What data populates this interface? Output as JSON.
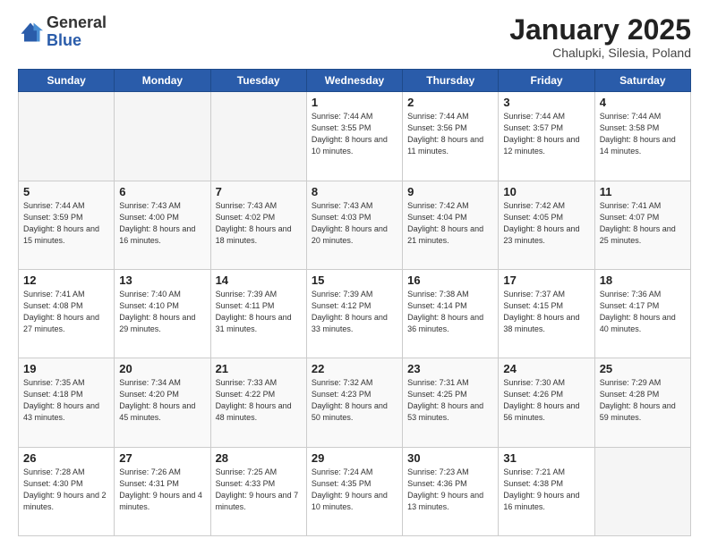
{
  "logo": {
    "general": "General",
    "blue": "Blue"
  },
  "header": {
    "month": "January 2025",
    "location": "Chalupki, Silesia, Poland"
  },
  "days_of_week": [
    "Sunday",
    "Monday",
    "Tuesday",
    "Wednesday",
    "Thursday",
    "Friday",
    "Saturday"
  ],
  "weeks": [
    [
      {
        "day": "",
        "empty": true
      },
      {
        "day": "",
        "empty": true
      },
      {
        "day": "",
        "empty": true
      },
      {
        "day": "1",
        "sunrise": "7:44 AM",
        "sunset": "3:55 PM",
        "daylight": "8 hours and 10 minutes."
      },
      {
        "day": "2",
        "sunrise": "7:44 AM",
        "sunset": "3:56 PM",
        "daylight": "8 hours and 11 minutes."
      },
      {
        "day": "3",
        "sunrise": "7:44 AM",
        "sunset": "3:57 PM",
        "daylight": "8 hours and 12 minutes."
      },
      {
        "day": "4",
        "sunrise": "7:44 AM",
        "sunset": "3:58 PM",
        "daylight": "8 hours and 14 minutes."
      }
    ],
    [
      {
        "day": "5",
        "sunrise": "7:44 AM",
        "sunset": "3:59 PM",
        "daylight": "8 hours and 15 minutes."
      },
      {
        "day": "6",
        "sunrise": "7:43 AM",
        "sunset": "4:00 PM",
        "daylight": "8 hours and 16 minutes."
      },
      {
        "day": "7",
        "sunrise": "7:43 AM",
        "sunset": "4:02 PM",
        "daylight": "8 hours and 18 minutes."
      },
      {
        "day": "8",
        "sunrise": "7:43 AM",
        "sunset": "4:03 PM",
        "daylight": "8 hours and 20 minutes."
      },
      {
        "day": "9",
        "sunrise": "7:42 AM",
        "sunset": "4:04 PM",
        "daylight": "8 hours and 21 minutes."
      },
      {
        "day": "10",
        "sunrise": "7:42 AM",
        "sunset": "4:05 PM",
        "daylight": "8 hours and 23 minutes."
      },
      {
        "day": "11",
        "sunrise": "7:41 AM",
        "sunset": "4:07 PM",
        "daylight": "8 hours and 25 minutes."
      }
    ],
    [
      {
        "day": "12",
        "sunrise": "7:41 AM",
        "sunset": "4:08 PM",
        "daylight": "8 hours and 27 minutes."
      },
      {
        "day": "13",
        "sunrise": "7:40 AM",
        "sunset": "4:10 PM",
        "daylight": "8 hours and 29 minutes."
      },
      {
        "day": "14",
        "sunrise": "7:39 AM",
        "sunset": "4:11 PM",
        "daylight": "8 hours and 31 minutes."
      },
      {
        "day": "15",
        "sunrise": "7:39 AM",
        "sunset": "4:12 PM",
        "daylight": "8 hours and 33 minutes."
      },
      {
        "day": "16",
        "sunrise": "7:38 AM",
        "sunset": "4:14 PM",
        "daylight": "8 hours and 36 minutes."
      },
      {
        "day": "17",
        "sunrise": "7:37 AM",
        "sunset": "4:15 PM",
        "daylight": "8 hours and 38 minutes."
      },
      {
        "day": "18",
        "sunrise": "7:36 AM",
        "sunset": "4:17 PM",
        "daylight": "8 hours and 40 minutes."
      }
    ],
    [
      {
        "day": "19",
        "sunrise": "7:35 AM",
        "sunset": "4:18 PM",
        "daylight": "8 hours and 43 minutes."
      },
      {
        "day": "20",
        "sunrise": "7:34 AM",
        "sunset": "4:20 PM",
        "daylight": "8 hours and 45 minutes."
      },
      {
        "day": "21",
        "sunrise": "7:33 AM",
        "sunset": "4:22 PM",
        "daylight": "8 hours and 48 minutes."
      },
      {
        "day": "22",
        "sunrise": "7:32 AM",
        "sunset": "4:23 PM",
        "daylight": "8 hours and 50 minutes."
      },
      {
        "day": "23",
        "sunrise": "7:31 AM",
        "sunset": "4:25 PM",
        "daylight": "8 hours and 53 minutes."
      },
      {
        "day": "24",
        "sunrise": "7:30 AM",
        "sunset": "4:26 PM",
        "daylight": "8 hours and 56 minutes."
      },
      {
        "day": "25",
        "sunrise": "7:29 AM",
        "sunset": "4:28 PM",
        "daylight": "8 hours and 59 minutes."
      }
    ],
    [
      {
        "day": "26",
        "sunrise": "7:28 AM",
        "sunset": "4:30 PM",
        "daylight": "9 hours and 2 minutes."
      },
      {
        "day": "27",
        "sunrise": "7:26 AM",
        "sunset": "4:31 PM",
        "daylight": "9 hours and 4 minutes."
      },
      {
        "day": "28",
        "sunrise": "7:25 AM",
        "sunset": "4:33 PM",
        "daylight": "9 hours and 7 minutes."
      },
      {
        "day": "29",
        "sunrise": "7:24 AM",
        "sunset": "4:35 PM",
        "daylight": "9 hours and 10 minutes."
      },
      {
        "day": "30",
        "sunrise": "7:23 AM",
        "sunset": "4:36 PM",
        "daylight": "9 hours and 13 minutes."
      },
      {
        "day": "31",
        "sunrise": "7:21 AM",
        "sunset": "4:38 PM",
        "daylight": "9 hours and 16 minutes."
      },
      {
        "day": "",
        "empty": true
      }
    ]
  ]
}
